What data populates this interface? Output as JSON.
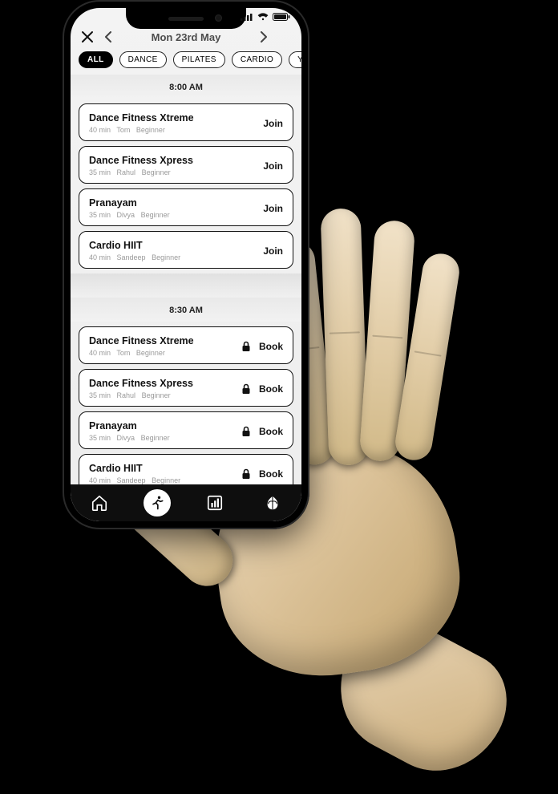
{
  "header": {
    "date_label": "Mon 23rd May"
  },
  "filters": [
    {
      "label": "ALL",
      "active": true
    },
    {
      "label": "DANCE",
      "active": false
    },
    {
      "label": "PILATES",
      "active": false
    },
    {
      "label": "CARDIO",
      "active": false
    },
    {
      "label": "YOGA",
      "active": false
    }
  ],
  "sections": [
    {
      "time": "8:00 AM",
      "classes": [
        {
          "name": "Dance Fitness Xtreme",
          "duration": "40 min",
          "instructor": "Tom",
          "level": "Beginner",
          "cta": "Join",
          "locked": false
        },
        {
          "name": "Dance Fitness Xpress",
          "duration": "35 min",
          "instructor": "Rahul",
          "level": "Beginner",
          "cta": "Join",
          "locked": false
        },
        {
          "name": "Pranayam",
          "duration": "35 min",
          "instructor": "Divya",
          "level": "Beginner",
          "cta": "Join",
          "locked": false
        },
        {
          "name": "Cardio HIIT",
          "duration": "40 min",
          "instructor": "Sandeep",
          "level": "Beginner",
          "cta": "Join",
          "locked": false
        }
      ]
    },
    {
      "time": "8:30 AM",
      "classes": [
        {
          "name": "Dance Fitness Xtreme",
          "duration": "40 min",
          "instructor": "Tom",
          "level": "Beginner",
          "cta": "Book",
          "locked": true
        },
        {
          "name": "Dance Fitness Xpress",
          "duration": "35 min",
          "instructor": "Rahul",
          "level": "Beginner",
          "cta": "Book",
          "locked": true
        },
        {
          "name": "Pranayam",
          "duration": "35 min",
          "instructor": "Divya",
          "level": "Beginner",
          "cta": "Book",
          "locked": true
        },
        {
          "name": "Cardio HIIT",
          "duration": "40 min",
          "instructor": "Sandeep",
          "level": "Beginner",
          "cta": "Book",
          "locked": true
        }
      ]
    }
  ],
  "bottom_tabs": [
    {
      "icon": "home",
      "active": false
    },
    {
      "icon": "run",
      "active": true
    },
    {
      "icon": "stats",
      "active": false
    },
    {
      "icon": "leaf",
      "active": false
    }
  ]
}
